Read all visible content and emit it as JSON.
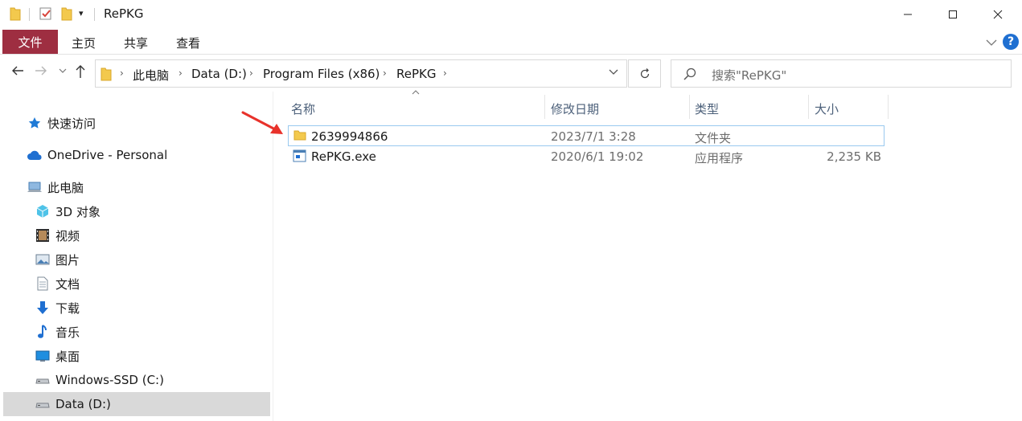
{
  "window": {
    "title": "RePKG",
    "controls": {
      "minimize": "minimize-icon",
      "maximize": "maximize-icon",
      "close": "close-icon"
    }
  },
  "ribbon": {
    "file_tab": "文件",
    "tabs": [
      "主页",
      "共享",
      "查看"
    ],
    "help": "?"
  },
  "address": {
    "segments": [
      "此电脑",
      "Data (D:)",
      "Program Files (x86)",
      "RePKG"
    ]
  },
  "search": {
    "placeholder": "搜索\"RePKG\""
  },
  "nav_pane": {
    "items": [
      {
        "label": "快速访问",
        "icon": "star-icon"
      },
      {
        "label": "OneDrive - Personal",
        "icon": "cloud-icon"
      },
      {
        "label": "此电脑",
        "icon": "computer-icon"
      },
      {
        "label": "3D 对象",
        "icon": "cube-icon"
      },
      {
        "label": "视频",
        "icon": "film-icon"
      },
      {
        "label": "图片",
        "icon": "picture-icon"
      },
      {
        "label": "文档",
        "icon": "document-icon"
      },
      {
        "label": "下载",
        "icon": "download-icon"
      },
      {
        "label": "音乐",
        "icon": "music-icon"
      },
      {
        "label": "桌面",
        "icon": "desktop-icon"
      },
      {
        "label": "Windows-SSD (C:)",
        "icon": "drive-icon"
      },
      {
        "label": "Data (D:)",
        "icon": "drive-icon"
      }
    ],
    "selected": "Data (D:)"
  },
  "file_list": {
    "columns": [
      "名称",
      "修改日期",
      "类型",
      "大小"
    ],
    "rows": [
      {
        "name": "2639994866",
        "modified": "2023/7/1 3:28",
        "type": "文件夹",
        "size": "",
        "icon": "folder-icon"
      },
      {
        "name": "RePKG.exe",
        "modified": "2020/6/1 19:02",
        "type": "应用程序",
        "size": "2,235 KB",
        "icon": "exe-icon"
      }
    ]
  },
  "colors": {
    "file_tab_bg": "#9e2e41",
    "selection_bg": "#d9d9d9",
    "hover_border": "#99c9ef",
    "annotation_arrow": "#e8322b"
  }
}
